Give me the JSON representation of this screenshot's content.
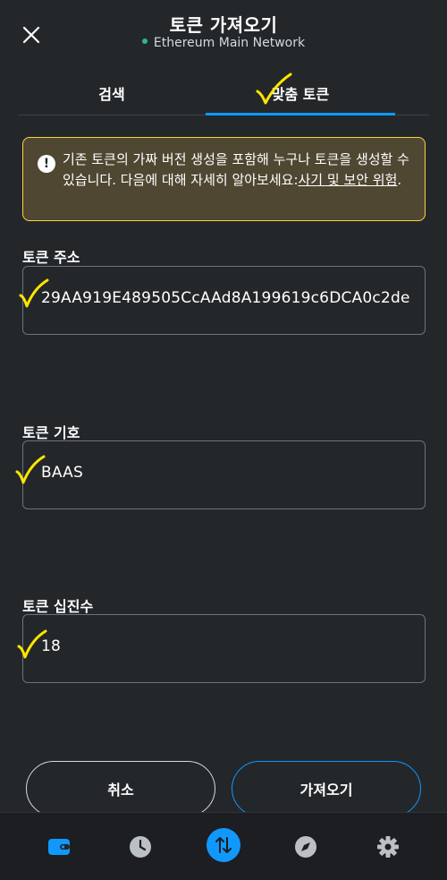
{
  "header": {
    "title": "토큰 가져오기",
    "network": "Ethereum Main Network"
  },
  "tabs": [
    {
      "label": "검색",
      "active": false
    },
    {
      "label": "맞춤 토큰",
      "active": true
    }
  ],
  "warning": {
    "text": "기존 토큰의 가짜 버전 생성을 포함해 누구나 토큰을 생성할 수 있습니다. 다음에 대해 자세히 알아보세요:",
    "link": "사기 및 보안 위험",
    "suffix": "."
  },
  "fields": {
    "address": {
      "label": "토큰 주소",
      "value": "29AA919E489505CcAAd8A199619c6DCA0c2de"
    },
    "symbol": {
      "label": "토큰 기호",
      "value": "BAAS"
    },
    "decimals": {
      "label": "토큰 십진수",
      "value": "18"
    }
  },
  "buttons": {
    "cancel": "취소",
    "import": "가져오기"
  },
  "nav": [
    "wallet-icon",
    "history-icon",
    "swap-icon",
    "explore-icon",
    "settings-icon"
  ],
  "colors": {
    "background": "#24272a",
    "accent": "#1098fc",
    "warning_border": "#ffd33d",
    "warning_bg": "#4f4732",
    "network_dot": "#2bb59a",
    "checkmark": "#ffe600"
  }
}
